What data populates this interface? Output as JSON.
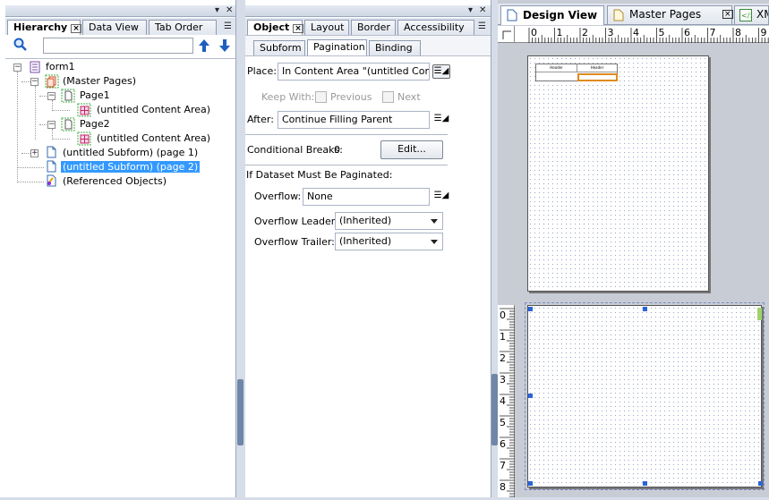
{
  "hierarchy_panel": {
    "tabs": [
      {
        "label": "Hierarchy",
        "active": true
      },
      {
        "label": "Data View",
        "active": false
      },
      {
        "label": "Tab Order",
        "active": false
      }
    ],
    "search_placeholder": "",
    "tree": [
      {
        "label": "form1",
        "level": 0,
        "icon": "form-icon"
      },
      {
        "label": "(Master Pages)",
        "level": 1,
        "icon": "master-pages-icon"
      },
      {
        "label": "Page1",
        "level": 2,
        "icon": "page-icon"
      },
      {
        "label": "(untitled Content Area)",
        "level": 3,
        "icon": "content-area-icon"
      },
      {
        "label": "Page2",
        "level": 2,
        "icon": "page-icon"
      },
      {
        "label": "(untitled Content Area)",
        "level": 3,
        "icon": "content-area-icon"
      },
      {
        "label": "(untitled Subform) (page 1)",
        "level": 1,
        "icon": "subform-icon"
      },
      {
        "label": "(untitled Subform) (page 2)",
        "level": 1,
        "icon": "subform-icon",
        "selected": true
      },
      {
        "label": "(Referenced Objects)",
        "level": 1,
        "icon": "referenced-objects-icon"
      }
    ]
  },
  "object_panel": {
    "tabs": [
      {
        "label": "Object",
        "active": true
      },
      {
        "label": "Layout",
        "active": false
      },
      {
        "label": "Border",
        "active": false
      },
      {
        "label": "Accessibility",
        "active": false
      }
    ],
    "subtabs": [
      {
        "label": "Subform",
        "active": false
      },
      {
        "label": "Pagination",
        "active": true
      },
      {
        "label": "Binding",
        "active": false
      }
    ],
    "place_label": "Place:",
    "place_value": "In Content Area \"(untitled Conten",
    "keep_with_label": "Keep With:",
    "previous_label": "Previous",
    "next_label": "Next",
    "after_label": "After:",
    "after_value": "Continue Filling Parent",
    "conditional_breaks_label": "Conditional Breaks:",
    "conditional_breaks_value": "0",
    "edit_button": "Edit...",
    "dataset_heading": "If Dataset Must Be Paginated:",
    "overflow_label": "Overflow:",
    "overflow_value": "None",
    "overflow_leader_label": "Overflow Leader:",
    "overflow_leader_value": "(Inherited)",
    "overflow_trailer_label": "Overflow Trailer:",
    "overflow_trailer_value": "(Inherited)"
  },
  "design_panel": {
    "tabs": [
      {
        "label": "Design View",
        "active": true
      },
      {
        "label": "Master Pages",
        "active": false
      },
      {
        "label": "XM",
        "active": false
      }
    ],
    "ruler_h_ticks": [
      "0",
      "1",
      "2",
      "3",
      "4",
      "5",
      "6",
      "7",
      "8",
      "9"
    ],
    "ruler_v_ticks": [
      "0",
      "1",
      "2",
      "3",
      "4",
      "5",
      "6",
      "7",
      "8"
    ],
    "mini_table_headers": [
      "Header",
      "Header"
    ]
  },
  "colors": {
    "selection": "#3399ff",
    "panel_bg": "#d6dde8",
    "handle": "#2a64d8"
  }
}
